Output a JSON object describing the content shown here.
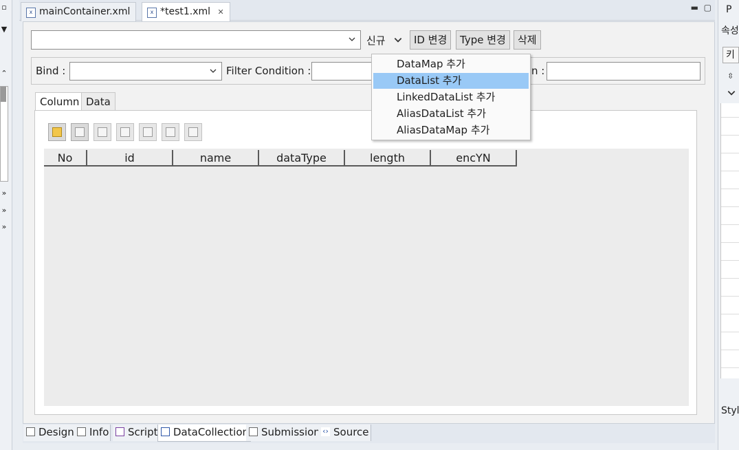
{
  "editor_tabs": [
    {
      "label": "mainContainer.xml",
      "active": false
    },
    {
      "label": "*test1.xml",
      "active": true
    }
  ],
  "toolbar": {
    "collection_value": "",
    "new_label": "신규",
    "id_change": "ID 변경",
    "type_change": "Type 변경",
    "delete": "삭제"
  },
  "bind_row": {
    "bind_label": "Bind :",
    "bind_value": "",
    "filter_label": "Filter Condition :",
    "filter_value": "",
    "colon_suffix": "n :",
    "right_value": ""
  },
  "inner_tabs": [
    {
      "label": "Column",
      "active": true
    },
    {
      "label": "Data",
      "active": false
    }
  ],
  "grid": {
    "columns": [
      "No",
      "id",
      "name",
      "dataType",
      "length",
      "encYN"
    ]
  },
  "new_menu": {
    "items": [
      "DataMap 추가",
      "DataList 추가",
      "LinkedDataList 추가",
      "AliasDataList 추가",
      "AliasDataMap 추가"
    ],
    "selected_index": 1
  },
  "bottom_tabs": [
    {
      "label": "Design",
      "active": false
    },
    {
      "label": "Info",
      "active": false
    },
    {
      "label": "Script",
      "active": false
    },
    {
      "label": "DataCollection",
      "active": true
    },
    {
      "label": "Submission",
      "active": false
    },
    {
      "label": "Source",
      "active": false
    }
  ],
  "right_panel": {
    "title": "P",
    "tab1": "속성",
    "tab2": "키",
    "style_label": "Style"
  },
  "colors": {
    "menu_highlight": "#99c9f6",
    "tab_active": "#ffffff",
    "grid_bg": "#ececec"
  }
}
